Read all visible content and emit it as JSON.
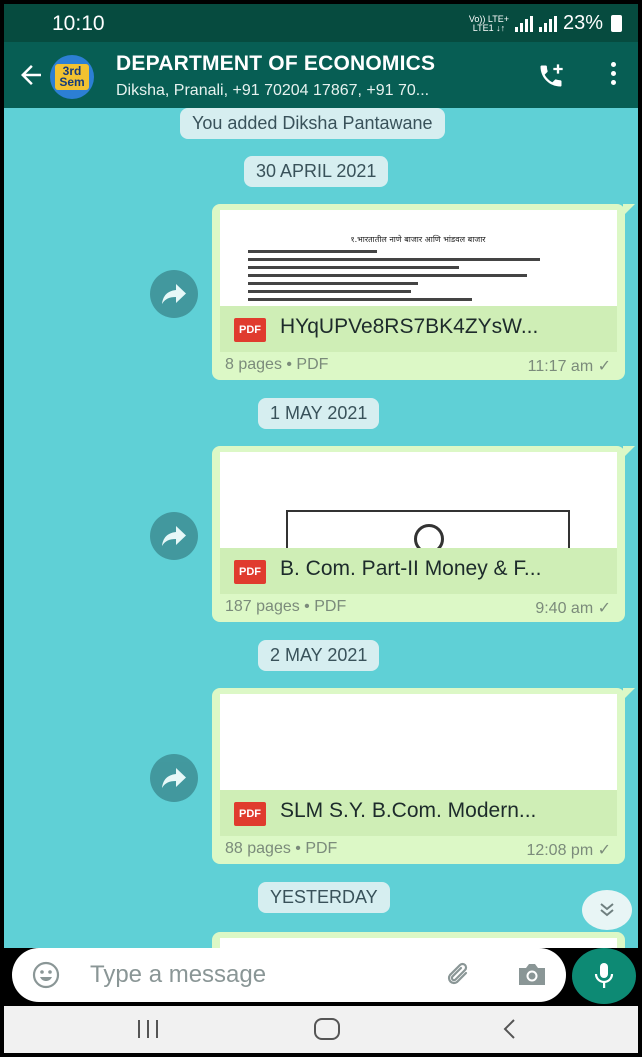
{
  "status_bar": {
    "time": "10:10",
    "network_top": "Vo)) LTE+",
    "network_bottom": "LTE1 ↓↑",
    "battery": "23%"
  },
  "app_bar": {
    "avatar_text_line1": "3rd",
    "avatar_text_line2": "Sem",
    "title": "DEPARTMENT OF ECONOMICS",
    "subtitle": "Diksha, Pranali, +91 70204 17867, +91 70..."
  },
  "chat": {
    "system_message": "You added Diksha Pantawane",
    "date_1": "30 APRIL 2021",
    "date_2": "1 MAY 2021",
    "date_3": "2 MAY 2021",
    "date_4": "YESTERDAY",
    "messages": [
      {
        "file_name": "HYqUPVe8RS7BK4ZYsW...",
        "badge": "PDF",
        "pages": "8 pages • PDF",
        "time": "11:17 am ✓",
        "preview_title": "१.भारतातील नाणे बाजार आणि भांडवल बाजार"
      },
      {
        "file_name": "B. Com. Part-II Money & F...",
        "badge": "PDF",
        "pages": "187 pages • PDF",
        "time": "9:40 am ✓"
      },
      {
        "file_name": "SLM S.Y. B.Com. Modern...",
        "badge": "PDF",
        "pages": "88 pages • PDF",
        "time": "12:08 pm ✓"
      }
    ]
  },
  "composer": {
    "placeholder": "Type a message"
  },
  "colors": {
    "header": "#075e54",
    "status_bar": "#064b3f",
    "chat_background": "#5fd0d6",
    "outgoing_bubble": "#dcf8c6",
    "mic_button": "#0d8a74"
  },
  "icons": {
    "back": "arrow-left-icon",
    "call": "add-call-icon",
    "menu": "more-vertical-icon",
    "forward": "forward-icon",
    "scroll": "double-chevron-down-icon",
    "emoji": "emoji-icon",
    "attach": "paperclip-icon",
    "camera": "camera-icon",
    "mic": "microphone-icon"
  }
}
